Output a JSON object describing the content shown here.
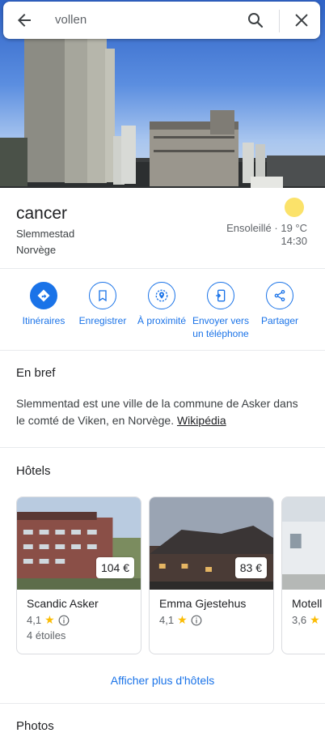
{
  "search": {
    "query": "vollen"
  },
  "place": {
    "title": "cancer",
    "locality": "Slemmestad",
    "country": "Norvège",
    "weather": "Ensoleillé · 19 °C",
    "time": "14:30"
  },
  "actions": [
    {
      "label": "Itinéraires",
      "icon": "directions-icon"
    },
    {
      "label": "Enregistrer",
      "icon": "bookmark-icon"
    },
    {
      "label": "À proximité",
      "icon": "nearby-icon"
    },
    {
      "label": "Envoyer vers un téléphone",
      "icon": "send-to-phone-icon"
    },
    {
      "label": "Partager",
      "icon": "share-icon"
    }
  ],
  "overview": {
    "heading": "En bref",
    "text": "Slemmentad est une ville de la commune de Asker dans le comté de Viken, en Norvège.",
    "link": "Wikipédia"
  },
  "hotels": {
    "heading": "Hôtels",
    "items": [
      {
        "name": "Scandic Asker",
        "price": "104 €",
        "rating": "4,1",
        "class": "4 étoiles"
      },
      {
        "name": "Emma Gjestehus",
        "price": "83 €",
        "rating": "4,1"
      },
      {
        "name": "Motell",
        "rating": "3,6"
      }
    ],
    "more_label": "Afficher plus d'hôtels"
  },
  "photos": {
    "heading": "Photos"
  },
  "colors": {
    "accent": "#1a73e8",
    "star": "#fbbc04",
    "sun": "#fbe26a"
  }
}
